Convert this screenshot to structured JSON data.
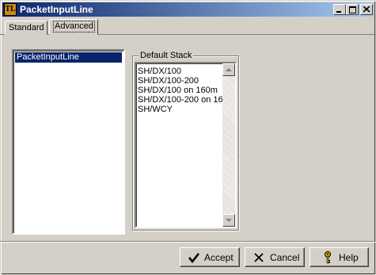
{
  "window": {
    "title": "PacketInputLine",
    "icon": "app-logo-icon",
    "icon_text": "TL",
    "controls": [
      "minimize-icon",
      "maximize-icon",
      "close-icon"
    ]
  },
  "tabs": [
    {
      "label": "Standard",
      "active": false
    },
    {
      "label": "Advanced",
      "active": true
    }
  ],
  "left_list": {
    "items": [
      "PacketInputLine"
    ],
    "selected_index": 0
  },
  "default_stack": {
    "label": "Default Stack",
    "items": [
      "SH/DX/100",
      "SH/DX/100-200",
      "SH/DX/100 on 160m",
      "SH/DX/100-200 on 16",
      "SH/WCY"
    ],
    "scroll_up_icon": "arrow-up-icon",
    "scroll_down_icon": "arrow-down-icon"
  },
  "buttons": {
    "accept": {
      "label": "Accept",
      "icon": "checkmark-icon"
    },
    "cancel": {
      "label": "Cancel",
      "icon": "x-icon"
    },
    "help": {
      "label": "Help",
      "icon": "key-icon"
    }
  },
  "colors": {
    "face": "#d4d0c8",
    "title_start": "#0a246a",
    "title_end": "#a6caf0",
    "selection": "#0a246a"
  }
}
